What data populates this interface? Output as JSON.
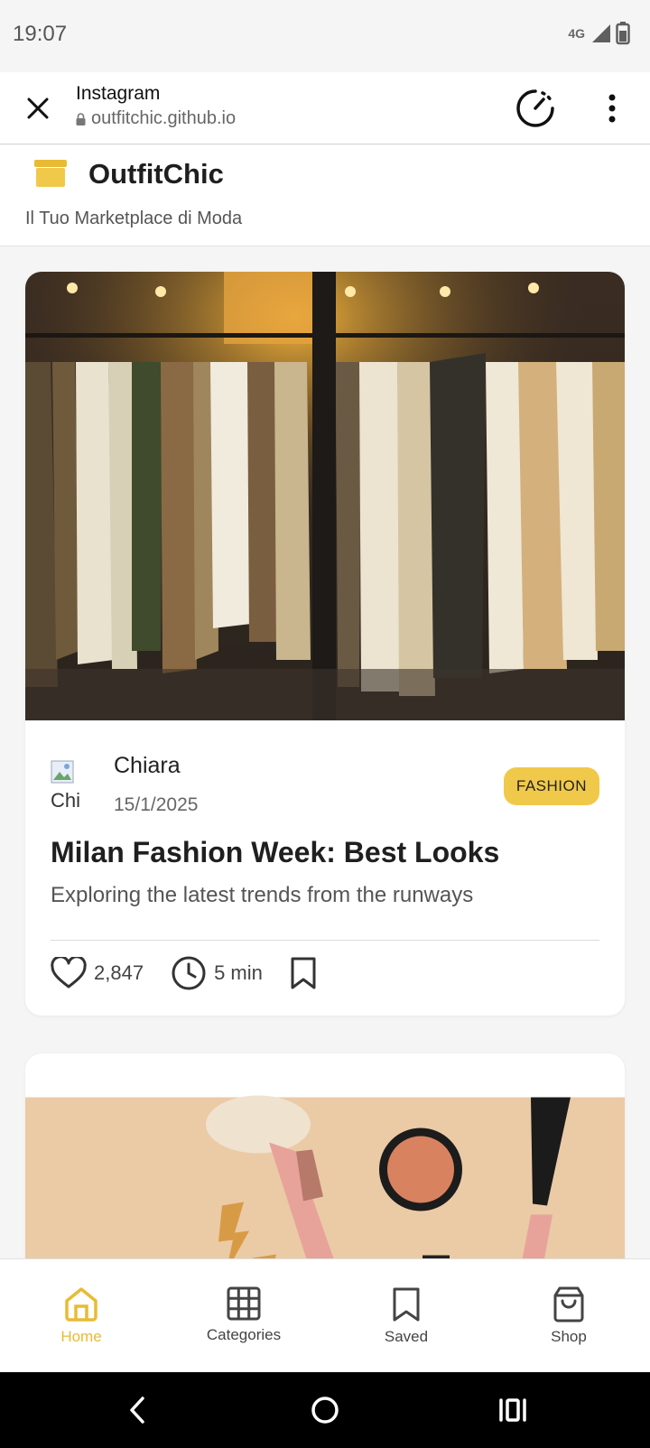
{
  "status_bar": {
    "time": "19:07",
    "network": "4G"
  },
  "browser": {
    "title": "Instagram",
    "url": "outfitchic.github.io"
  },
  "site": {
    "brand": "OutfitChic",
    "tagline": "Il Tuo Marketplace di Moda",
    "accent_color": "#F0C94A"
  },
  "posts": [
    {
      "author": "Chiara",
      "avatar_alt": "Chi",
      "date": "15/1/2025",
      "category": "FASHION",
      "title": "Milan Fashion Week: Best Looks",
      "subtitle": "Exploring the latest trends from the runways",
      "likes": "2,847",
      "read_time": "5 min",
      "image": "clothing-rack-photo"
    },
    {
      "image": "makeup-products-photo"
    }
  ],
  "bottom_nav": [
    {
      "label": "Home",
      "icon": "home-icon",
      "active": true
    },
    {
      "label": "Categories",
      "icon": "grid-icon",
      "active": false
    },
    {
      "label": "Saved",
      "icon": "bookmark-icon",
      "active": false
    },
    {
      "label": "Shop",
      "icon": "shopping-bag-icon",
      "active": false
    }
  ]
}
